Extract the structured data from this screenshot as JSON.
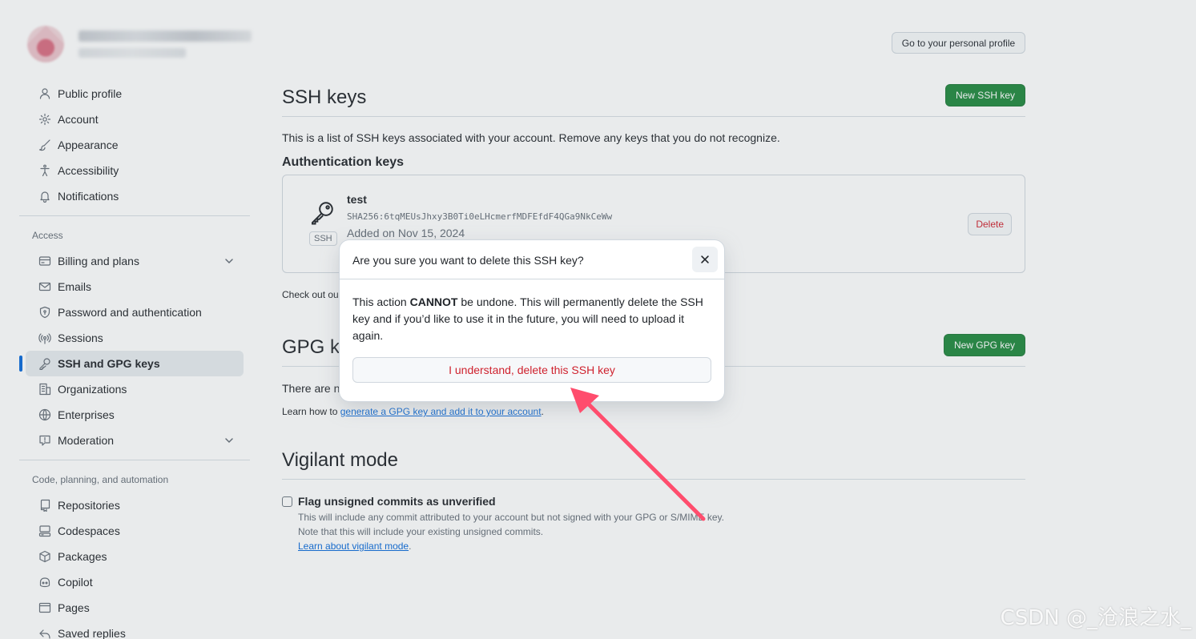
{
  "header": {
    "profile_button": "Go to your personal profile"
  },
  "sidebar": {
    "items_top": [
      {
        "label": "Public profile",
        "icon": "person-icon"
      },
      {
        "label": "Account",
        "icon": "gear-icon"
      },
      {
        "label": "Appearance",
        "icon": "paintbrush-icon"
      },
      {
        "label": "Accessibility",
        "icon": "accessibility-icon"
      },
      {
        "label": "Notifications",
        "icon": "bell-icon"
      }
    ],
    "access_heading": "Access",
    "items_access": [
      {
        "label": "Billing and plans",
        "icon": "credit-card-icon",
        "expandable": true
      },
      {
        "label": "Emails",
        "icon": "mail-icon"
      },
      {
        "label": "Password and authentication",
        "icon": "shield-lock-icon"
      },
      {
        "label": "Sessions",
        "icon": "broadcast-icon"
      },
      {
        "label": "SSH and GPG keys",
        "icon": "key-icon",
        "active": true
      },
      {
        "label": "Organizations",
        "icon": "organization-icon"
      },
      {
        "label": "Enterprises",
        "icon": "globe-icon"
      },
      {
        "label": "Moderation",
        "icon": "report-icon",
        "expandable": true
      }
    ],
    "code_heading": "Code, planning, and automation",
    "items_code": [
      {
        "label": "Repositories",
        "icon": "repo-icon"
      },
      {
        "label": "Codespaces",
        "icon": "codespaces-icon"
      },
      {
        "label": "Packages",
        "icon": "package-icon"
      },
      {
        "label": "Copilot",
        "icon": "copilot-icon"
      },
      {
        "label": "Pages",
        "icon": "browser-icon"
      },
      {
        "label": "Saved replies",
        "icon": "reply-icon"
      }
    ]
  },
  "ssh": {
    "title": "SSH keys",
    "new_button": "New SSH key",
    "description": "This is a list of SSH keys associated with your account. Remove any keys that you do not recognize.",
    "auth_title": "Authentication keys",
    "key": {
      "name": "test",
      "fingerprint": "SHA256:6tqMEUsJhxy3B0Ti0eLHcmerfMDFEfdF4QGa9NkCeWw",
      "added": "Added on Nov 15, 2024",
      "badge": "SSH",
      "delete_label": "Delete"
    },
    "checkout_text": "Check out ou"
  },
  "gpg": {
    "title": "GPG ke",
    "new_button": "New GPG key",
    "none_text": "There are no",
    "learn_prefix": "Learn how to ",
    "learn_link": "generate a GPG key and add it to your account",
    "learn_suffix": "."
  },
  "vigilant": {
    "title": "Vigilant mode",
    "checkbox_label": "Flag unsigned commits as unverified",
    "line1": "This will include any commit attributed to your account but not signed with your GPG or S/MIME key.",
    "line2": "Note that this will include your existing unsigned commits.",
    "link": "Learn about vigilant mode",
    "link_suffix": "."
  },
  "dialog": {
    "title": "Are you sure you want to delete this SSH key?",
    "body_prefix": "This action ",
    "body_strong": "CANNOT",
    "body_suffix": " be undone. This will permanently delete the SSH key and if you’d like to use it in the future, you will need to upload it again.",
    "confirm_label": "I understand, delete this SSH key"
  },
  "watermark": "CSDN @_沧浪之水_",
  "colors": {
    "accent": "#0969da",
    "green": "#1f883d",
    "danger": "#cf222e",
    "arrow": "#ff4d6d"
  }
}
